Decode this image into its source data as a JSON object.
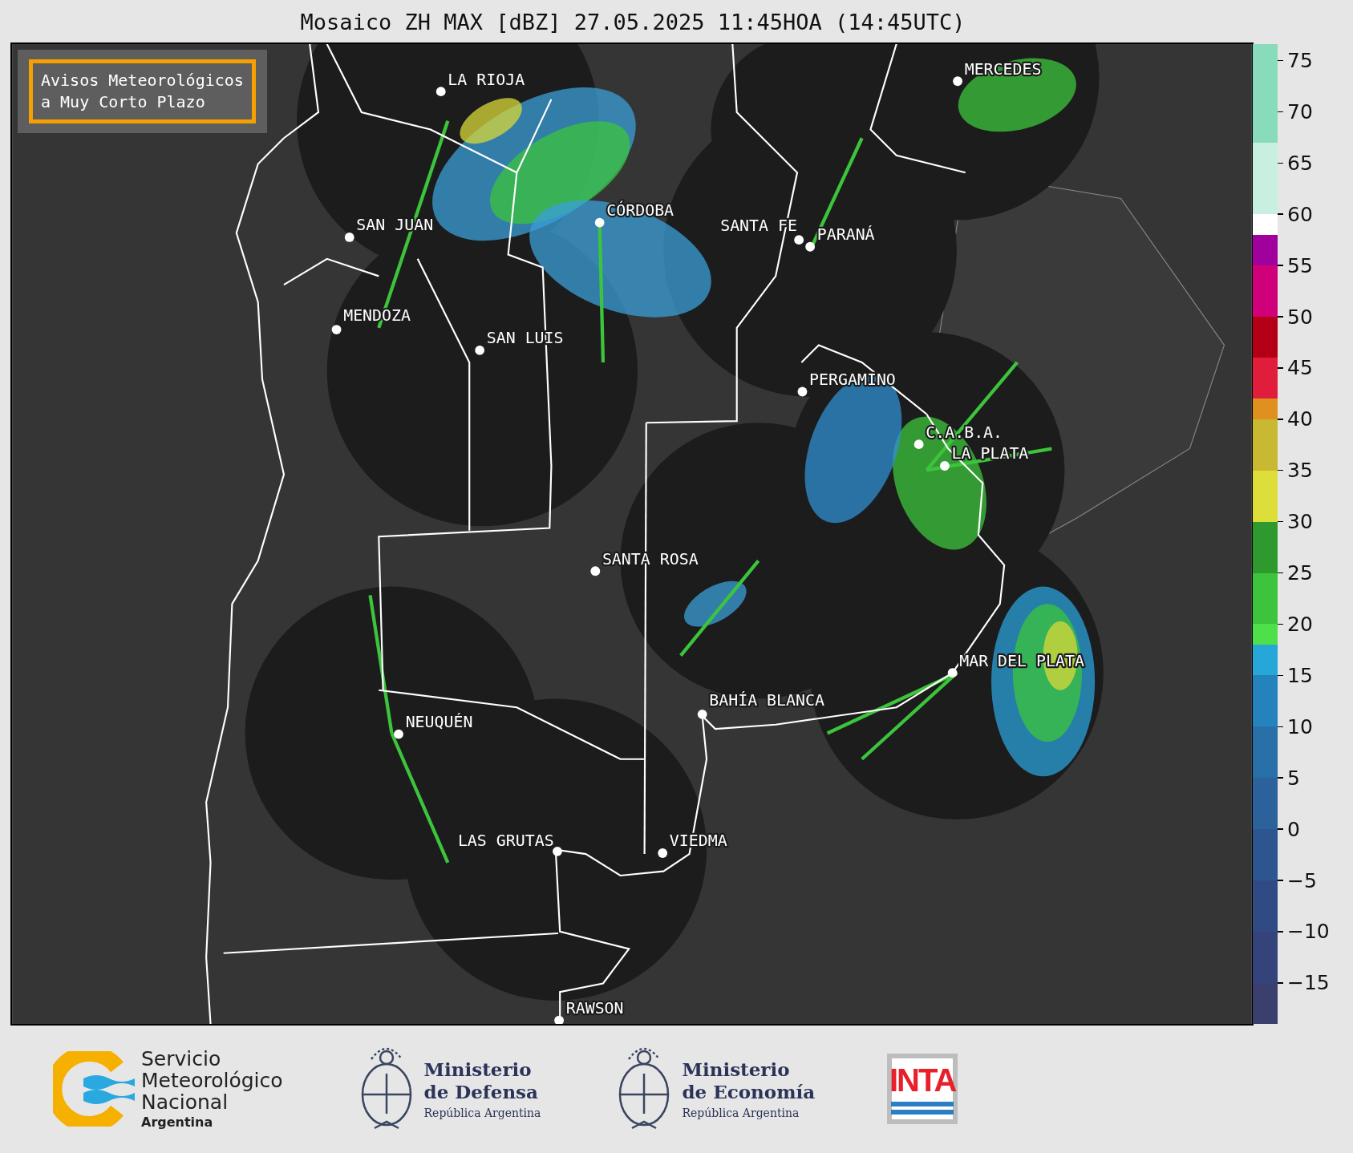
{
  "title": "Mosaico ZH MAX [dBZ] 27.05.2025 11:45HOA (14:45UTC)",
  "map": {
    "notice": "Avisos Meteorológicos\na Muy Corto Plazo",
    "cities": [
      {
        "name": "LA RIOJA"
      },
      {
        "name": "CÓRDOBA"
      },
      {
        "name": "SAN JUAN"
      },
      {
        "name": "SANTA FE"
      },
      {
        "name": "PARANÁ"
      },
      {
        "name": "MENDOZA"
      },
      {
        "name": "SAN LUIS"
      },
      {
        "name": "MERCEDES"
      },
      {
        "name": "PERGAMINO"
      },
      {
        "name": "C.A.B.A."
      },
      {
        "name": "LA PLATA"
      },
      {
        "name": "SANTA ROSA"
      },
      {
        "name": "MAR DEL PLATA"
      },
      {
        "name": "BAHÍA BLANCA"
      },
      {
        "name": "NEUQUÉN"
      },
      {
        "name": "LAS GRUTAS"
      },
      {
        "name": "VIEDMA"
      },
      {
        "name": "RAWSON"
      }
    ]
  },
  "colorbar": {
    "ticks": [
      "75",
      "70",
      "65",
      "60",
      "55",
      "50",
      "45",
      "40",
      "35",
      "30",
      "25",
      "20",
      "15",
      "10",
      "5",
      "0",
      "−5",
      "−10",
      "−15"
    ]
  },
  "logos": [
    {
      "kind": "smn",
      "lines": [
        "Servicio",
        "Meteorológico",
        "Nacional"
      ],
      "subtitle": "Argentina"
    },
    {
      "kind": "ministry",
      "lines": [
        "Ministerio",
        "de Defensa"
      ],
      "subtitle": "República Argentina"
    },
    {
      "kind": "ministry",
      "lines": [
        "Ministerio",
        "de Economía"
      ],
      "subtitle": "República Argentina"
    },
    {
      "kind": "inta",
      "text": "INTA"
    }
  ]
}
